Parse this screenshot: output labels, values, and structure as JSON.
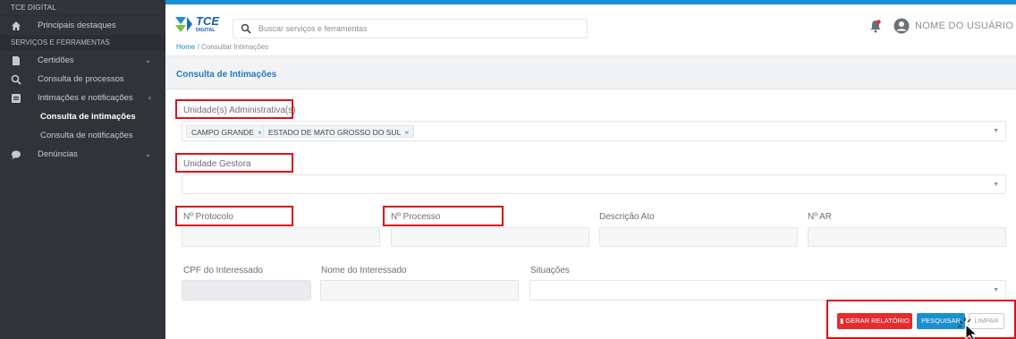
{
  "app": {
    "brand": "TCE DIGITAL",
    "logo_text": "TCE",
    "logo_sub": "DIGITAL"
  },
  "sidebar": {
    "home": {
      "label": "Principais destaques",
      "icon": "home-icon"
    },
    "section": "SERVIÇOS E FERRAMENTAS",
    "items": [
      {
        "label": "Certidões",
        "icon": "document-icon"
      },
      {
        "label": "Consulta de processos",
        "icon": "search-icon"
      },
      {
        "label": "Intimações e notificações",
        "icon": "notice-icon"
      }
    ],
    "subitems": [
      {
        "label": "Consulta de intimações",
        "active": true
      },
      {
        "label": "Consulta de notificações",
        "active": false
      }
    ],
    "denuncias": {
      "label": "Denúncias",
      "icon": "chat-icon"
    }
  },
  "header": {
    "search_placeholder": "Buscar serviços e ferramentas",
    "breadcrumb_home": "Home",
    "breadcrumb_sep": "/",
    "breadcrumb_current": "Consultar Intimações",
    "user_name": "NOME DO USUÁRIO"
  },
  "page": {
    "title": "Consulta de Intimações"
  },
  "form": {
    "unidades_label": "Unidade(s) Administrativa(s)",
    "unidades_tags": [
      "CAMPO GRANDE",
      "ESTADO DE MATO GROSSO DO SUL"
    ],
    "tag_remove": "×",
    "unidade_gestora_label": "Unidade Gestora",
    "protocolo_label": "Nº Protocolo",
    "processo_label": "Nº Processo",
    "descricao_label": "Descrição Ato",
    "ar_label": "Nº AR",
    "cpf_label": "CPF do Interessado",
    "nome_label": "Nome do Interessado",
    "situacoes_label": "Situações"
  },
  "buttons": {
    "gerar": "GERAR RELATÓRIO",
    "pesquisar": "PESQUISAR",
    "limpar": "LIMPAR"
  },
  "colors": {
    "sidebar_bg": "#303439",
    "accent": "#1c8fd0",
    "highlight": "#d9121b",
    "report_button": "#e52d2d"
  }
}
